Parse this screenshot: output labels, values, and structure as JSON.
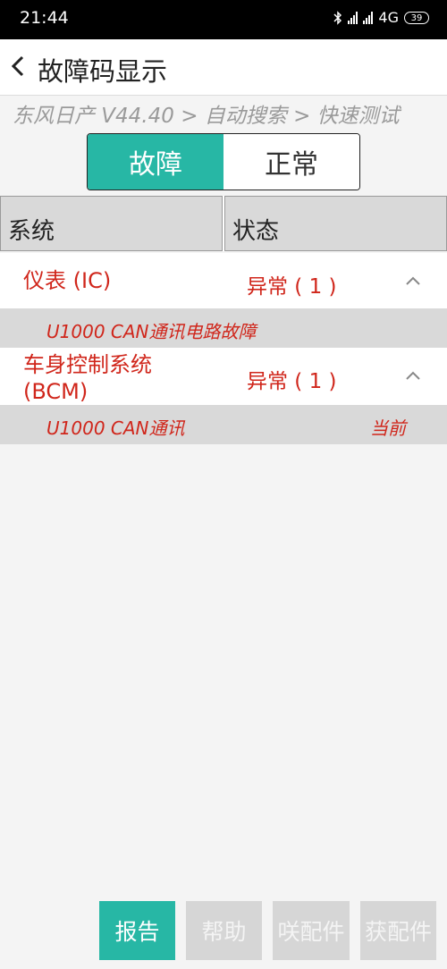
{
  "status_bar": {
    "time": "21:44",
    "network": "4G",
    "battery": "39"
  },
  "app_bar": {
    "back_icon": "chevron-left-icon",
    "title": "故障码显示"
  },
  "breadcrumb": "东风日产 V44.40 > 自动搜索 > 快速测试",
  "toggle": {
    "fault_label": "故障",
    "normal_label": "正常",
    "selected": "故障"
  },
  "table": {
    "columns": [
      "系统",
      "状态"
    ],
    "rows": [
      {
        "system": "仪表 (IC)",
        "status": "异常 ( 1 )",
        "fault_code": "U1000 CAN通讯电路故障",
        "fault_state": ""
      },
      {
        "system_line1": "车身控制系统",
        "system_line2": "(BCM)",
        "status": "异常 ( 1 )",
        "fault_code": "U1000 CAN通讯",
        "fault_state": "当前"
      }
    ]
  },
  "bottom_buttons": {
    "report": "报告",
    "help": "帮助",
    "parts1": "咲配件",
    "parts2": "获配件"
  },
  "colors": {
    "accent": "#27b7a5",
    "error_text": "#d0261b",
    "header_bg": "#d9d9d9"
  }
}
